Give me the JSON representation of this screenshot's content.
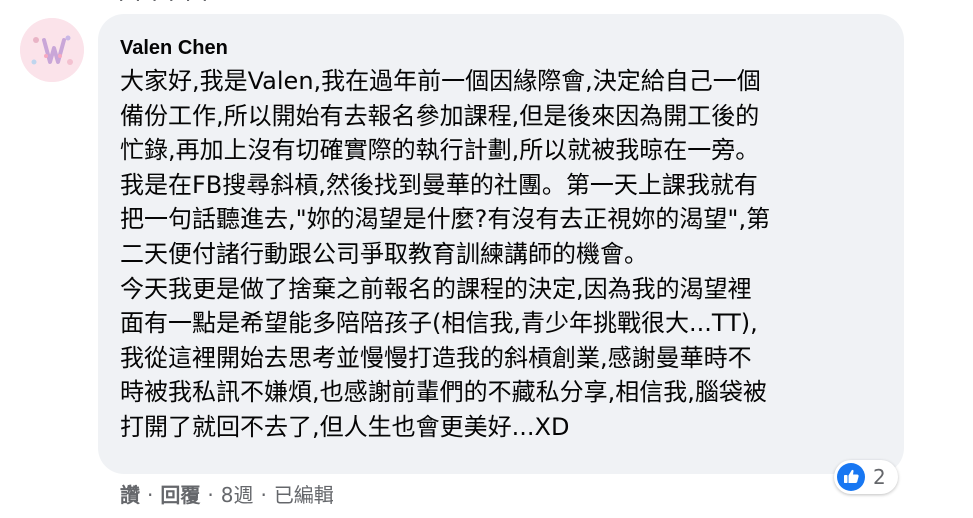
{
  "comment": {
    "author": "Valen Chen",
    "lines": [
      "大家好,我是Valen,我在過年前一個因緣際會,決定給自己一個",
      "備份工作,所以開始有去報名參加課程,但是後來因為開工後的",
      "忙錄,再加上沒有切確實際的執行計劃,所以就被我晾在一旁。",
      "我是在FB搜尋斜槓,然後找到曼華的社團。第一天上課我就有",
      "把一句話聽進去,\"妳的渴望是什麼?有沒有去正視妳的渴望\",第",
      "二天便付諸行動跟公司爭取教育訓練講師的機會。",
      "今天我更是做了捨棄之前報名的課程的決定,因為我的渴望裡",
      "面有一點是希望能多陪陪孩子(相信我,青少年挑戰很大...TT),",
      "我從這裡開始去思考並慢慢打造我的斜槓創業,感謝曼華時不",
      "時被我私訊不嫌煩,也感謝前輩們的不藏私分享,相信我,腦袋被",
      "打開了就回不去了,但人生也會更美好...XD"
    ],
    "reaction_count": "2",
    "actions": {
      "like": "讚",
      "reply": "回覆",
      "time": "8週",
      "edited": "已編輯",
      "separator": "·"
    }
  },
  "colors": {
    "bubble": "#f0f2f5",
    "text": "#050505",
    "secondary": "#65676b",
    "like_blue": "#1877f2"
  }
}
